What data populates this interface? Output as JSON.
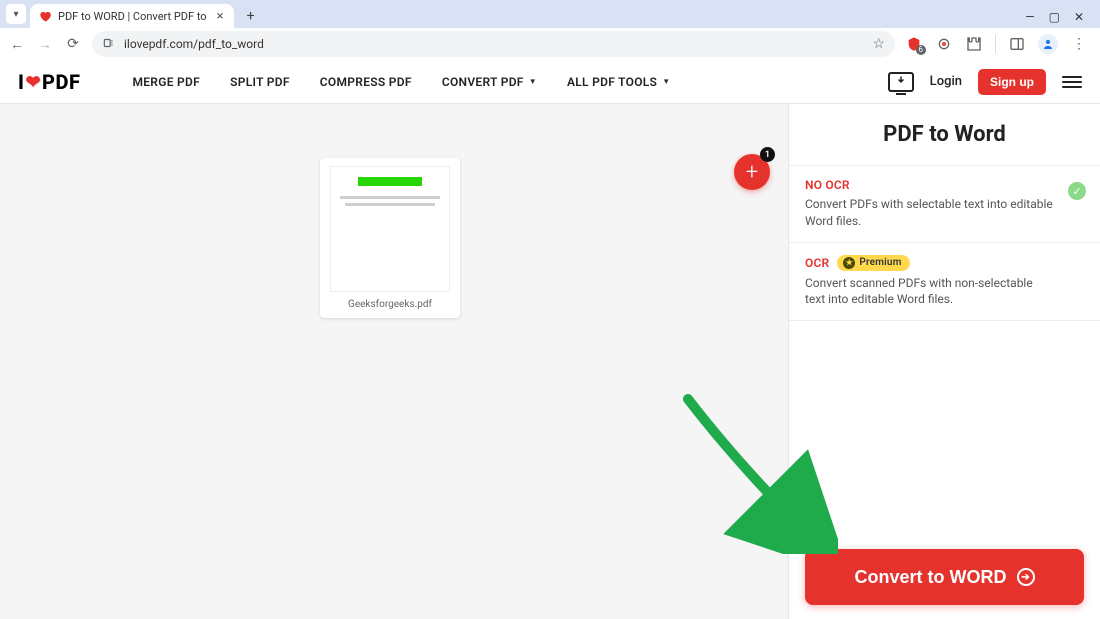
{
  "browser": {
    "tab_title": "PDF to WORD | Convert PDF to",
    "url": "ilovepdf.com/pdf_to_word",
    "ext_badge": "6"
  },
  "nav": {
    "logo_left": "I",
    "logo_right": "PDF",
    "links": {
      "merge": "MERGE PDF",
      "split": "SPLIT PDF",
      "compress": "COMPRESS PDF",
      "convert": "CONVERT PDF",
      "all": "ALL PDF TOOLS"
    },
    "login": "Login",
    "signup": "Sign up"
  },
  "file": {
    "name": "Geeksforgeeks.pdf",
    "add_badge": "1"
  },
  "sidebar": {
    "title": "PDF to Word",
    "opt1_title": "NO OCR",
    "opt1_desc": "Convert PDFs with selectable text into editable Word files.",
    "opt2_title": "OCR",
    "opt2_desc": "Convert scanned PDFs with non-selectable text into editable Word files.",
    "premium": "Premium",
    "convert": "Convert to WORD"
  }
}
